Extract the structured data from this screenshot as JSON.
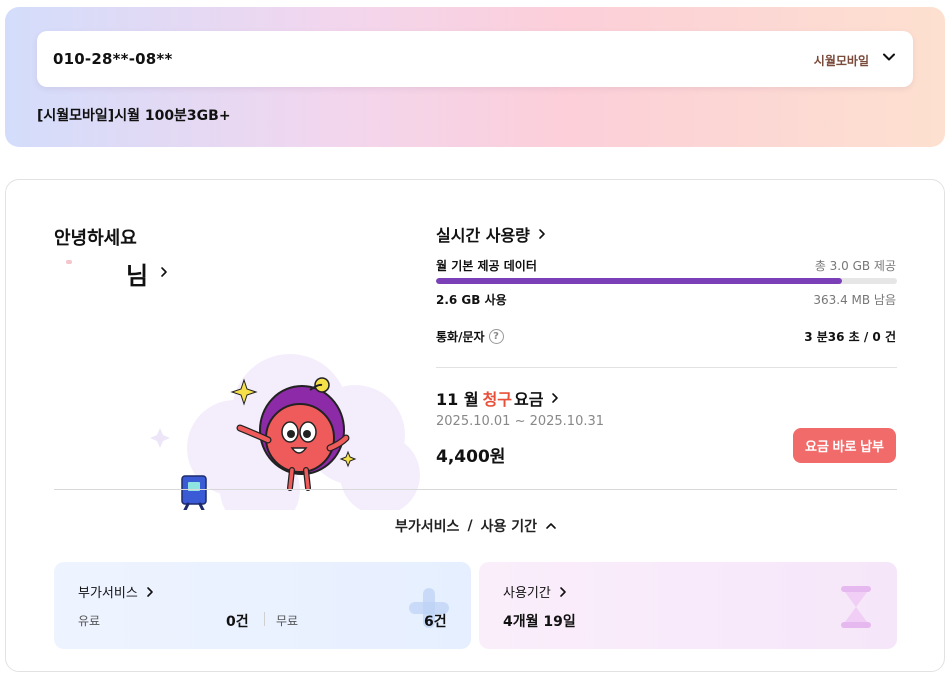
{
  "line": {
    "phone_number": "010-28**-08**",
    "carrier": "시월모바일",
    "plan_name": "[시월모바일]시월 100분3GB+"
  },
  "greeting": {
    "hello": "안녕하세요",
    "name_suffix": "님"
  },
  "usage": {
    "title": "실시간 사용량",
    "data_label": "월 기본 제공 데이터",
    "data_total": "총 3.0 GB 제공",
    "data_used": "2.6 GB 사용",
    "data_remaining": "363.4 MB 남음",
    "data_used_fraction": 0.88,
    "call_label": "통화/문자",
    "call_value": "3 분36 초 / 0 건"
  },
  "bill": {
    "title_prefix": "11 월",
    "title_accent": "청구",
    "title_suffix": "요금",
    "period": "2025.10.01 ~ 2025.10.31",
    "amount": "4,400원",
    "pay_button": "요금 바로 납부"
  },
  "details_toggle": {
    "label_addon": "부가서비스",
    "separator": "/",
    "label_period": "사용 기간"
  },
  "addon_panel": {
    "title": "부가서비스",
    "paid_label": "유료",
    "paid_value": "0건",
    "free_label": "무료",
    "free_value": "6건"
  },
  "period_panel": {
    "title": "사용기간",
    "value": "4개월 19일"
  },
  "colors": {
    "progress": "#7b3fb8",
    "pay_button": "#f26b6b",
    "accent": "#e8503a"
  }
}
